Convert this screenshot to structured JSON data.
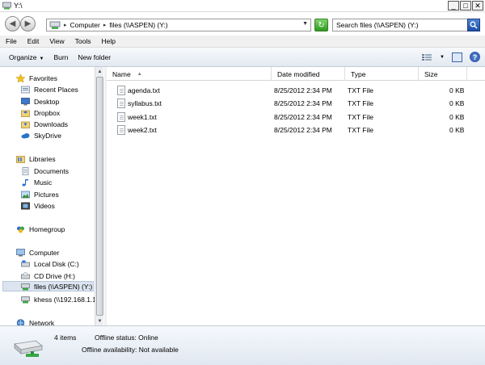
{
  "window": {
    "title": "Y:\\",
    "minimize": "_",
    "maximize": "□",
    "close": "✕"
  },
  "nav": {
    "back": "◀",
    "forward": "▶"
  },
  "address": {
    "segments": [
      "Computer",
      "files (\\\\ASPEN) (Y:)"
    ]
  },
  "search": {
    "placeholder": "Search files (\\\\ASPEN) (Y:)"
  },
  "menu": [
    "File",
    "Edit",
    "View",
    "Tools",
    "Help"
  ],
  "toolbar": {
    "organize": "Organize",
    "burn": "Burn",
    "new_folder": "New folder"
  },
  "sidebar": {
    "favorites": {
      "label": "Favorites",
      "items": [
        "Recent Places",
        "Desktop",
        "Dropbox",
        "Downloads",
        "SkyDrive"
      ]
    },
    "libraries": {
      "label": "Libraries",
      "items": [
        "Documents",
        "Music",
        "Pictures",
        "Videos"
      ]
    },
    "homegroup": {
      "label": "Homegroup"
    },
    "computer": {
      "label": "Computer",
      "items": [
        "Local Disk (C:)",
        "CD Drive (H:)",
        "files (\\\\ASPEN) (Y:)",
        "khess (\\\\192.168.1.1"
      ]
    },
    "network": {
      "label": "Network"
    }
  },
  "columns": {
    "name": "Name",
    "date": "Date modified",
    "type": "Type",
    "size": "Size"
  },
  "files": [
    {
      "name": "agenda.txt",
      "date": "8/25/2012 2:34 PM",
      "type": "TXT File",
      "size": "0 KB"
    },
    {
      "name": "syllabus.txt",
      "date": "8/25/2012 2:34 PM",
      "type": "TXT File",
      "size": "0 KB"
    },
    {
      "name": "week1.txt",
      "date": "8/25/2012 2:34 PM",
      "type": "TXT File",
      "size": "0 KB"
    },
    {
      "name": "week2.txt",
      "date": "8/25/2012 2:34 PM",
      "type": "TXT File",
      "size": "0 KB"
    }
  ],
  "status": {
    "count": "4 items",
    "offline_status": "Offline status: Online",
    "offline_availability": "Offline availability: Not available"
  }
}
